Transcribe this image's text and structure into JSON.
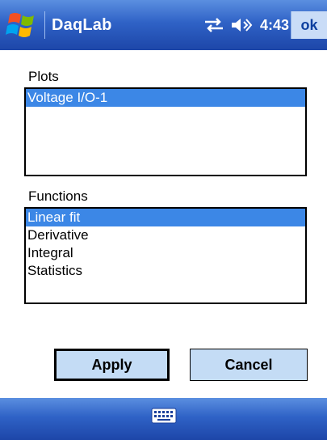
{
  "titlebar": {
    "app_title": "DaqLab",
    "clock": "4:43",
    "ok_label": "ok",
    "icons": [
      "windows-start-icon",
      "connectivity-icon",
      "volume-icon"
    ]
  },
  "plots": {
    "label": "Plots",
    "items": [
      {
        "label": "Voltage I/O-1",
        "selected": true
      }
    ]
  },
  "functions": {
    "label": "Functions",
    "items": [
      {
        "label": "Linear fit",
        "selected": true
      },
      {
        "label": "Derivative",
        "selected": false
      },
      {
        "label": "Integral",
        "selected": false
      },
      {
        "label": "Statistics",
        "selected": false
      }
    ]
  },
  "buttons": {
    "apply_label": "Apply",
    "cancel_label": "Cancel"
  },
  "bottombar": {
    "icons": [
      "keyboard-icon"
    ]
  },
  "colors": {
    "titlebar": "#2f62c6",
    "selection": "#3c87e6",
    "button_bg": "#c4dcf5"
  }
}
